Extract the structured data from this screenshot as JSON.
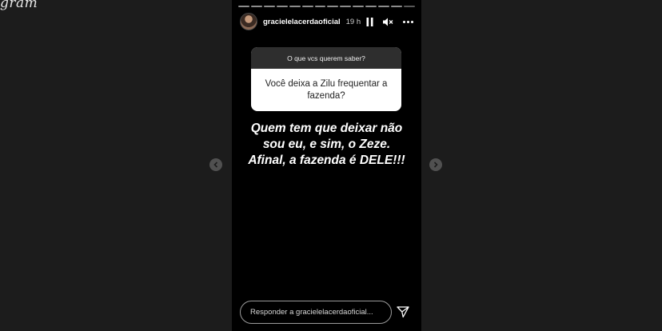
{
  "brand": {
    "logo_text": "gram"
  },
  "story": {
    "username": "gracielelacerdaoficial",
    "time": "19 h",
    "question_box": {
      "title": "O que vcs querem saber?",
      "answer": "Você deixa a Zilu frequentar a fazenda?"
    },
    "caption": "Quem tem que deixar não\nsou eu, e sim, o Zeze.\nAfinal, a fazenda é DELE!!!",
    "reply": {
      "placeholder": "Responder a gracielelacerdaoficial..."
    }
  },
  "icons": {
    "pause": "pause-icon",
    "mute": "speaker-muted-icon",
    "more": "more-options-icon",
    "send": "paper-plane-icon",
    "prev": "chevron-left-icon",
    "next": "chevron-right-icon"
  }
}
